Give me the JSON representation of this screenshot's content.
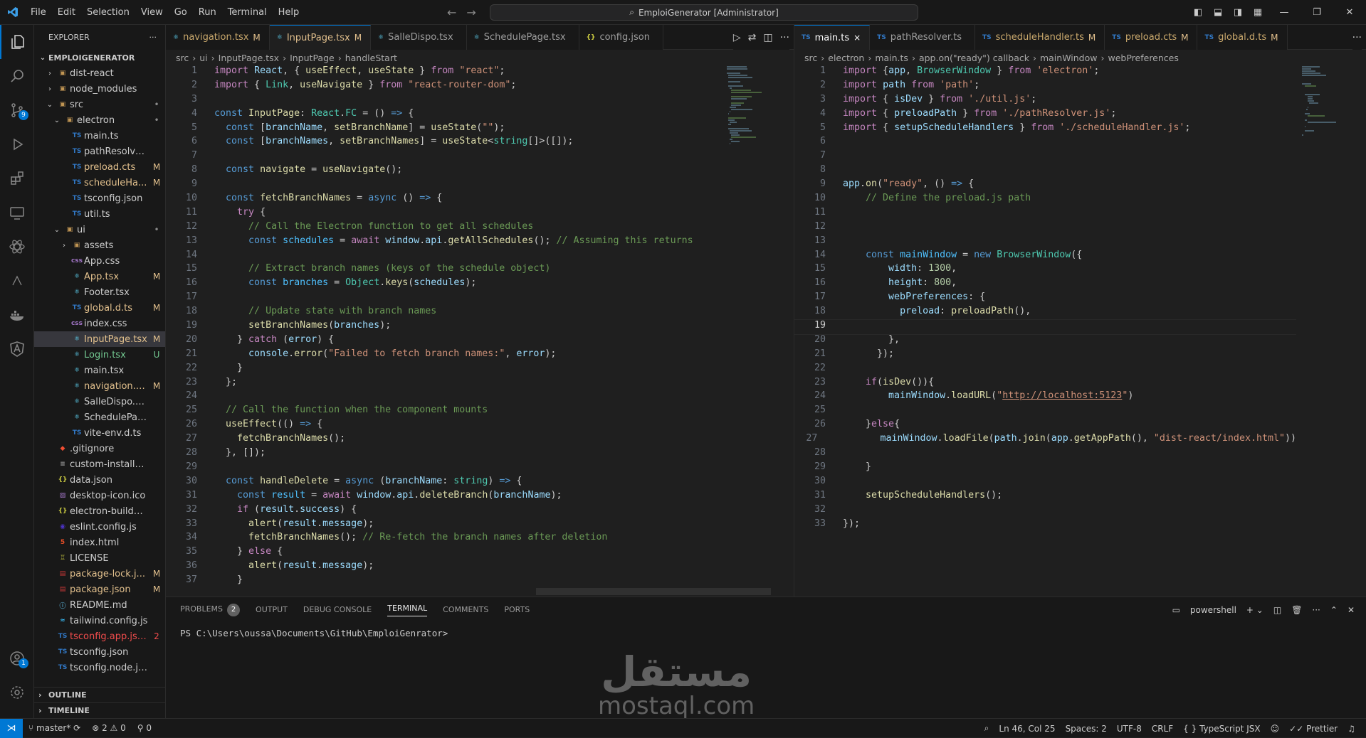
{
  "titlebar": {
    "menu": [
      "File",
      "Edit",
      "Selection",
      "View",
      "Go",
      "Run",
      "Terminal",
      "Help"
    ],
    "command_center": "EmploiGenerator [Administrator]"
  },
  "activity": {
    "source_control_badge": "9",
    "account_badge": "1"
  },
  "explorer": {
    "title": "EXPLORER",
    "root": "EMPLOIGENERATOR",
    "items": [
      {
        "name": "dist-react",
        "kind": "folder",
        "indent": 1,
        "status": ""
      },
      {
        "name": "node_modules",
        "kind": "folder",
        "indent": 1,
        "status": ""
      },
      {
        "name": "src",
        "kind": "folder-open",
        "indent": 1,
        "status": "•"
      },
      {
        "name": "electron",
        "kind": "folder-open",
        "indent": 2,
        "status": "•"
      },
      {
        "name": "main.ts",
        "kind": "ts",
        "indent": 3,
        "status": ""
      },
      {
        "name": "pathResolver.ts",
        "kind": "ts",
        "indent": 3,
        "status": ""
      },
      {
        "name": "preload.cts",
        "kind": "ts",
        "indent": 3,
        "status": "M"
      },
      {
        "name": "scheduleHa...",
        "kind": "ts",
        "indent": 3,
        "status": "M"
      },
      {
        "name": "tsconfig.json",
        "kind": "ts",
        "indent": 3,
        "status": ""
      },
      {
        "name": "util.ts",
        "kind": "ts",
        "indent": 3,
        "status": ""
      },
      {
        "name": "ui",
        "kind": "folder-open",
        "indent": 2,
        "status": "•"
      },
      {
        "name": "assets",
        "kind": "folder",
        "indent": 3,
        "status": ""
      },
      {
        "name": "App.css",
        "kind": "css",
        "indent": 3,
        "status": ""
      },
      {
        "name": "App.tsx",
        "kind": "react",
        "indent": 3,
        "status": "M"
      },
      {
        "name": "Footer.tsx",
        "kind": "react",
        "indent": 3,
        "status": ""
      },
      {
        "name": "global.d.ts",
        "kind": "ts",
        "indent": 3,
        "status": "M"
      },
      {
        "name": "index.css",
        "kind": "css",
        "indent": 3,
        "status": ""
      },
      {
        "name": "InputPage.tsx",
        "kind": "react",
        "indent": 3,
        "status": "M",
        "selected": true
      },
      {
        "name": "Login.tsx",
        "kind": "react",
        "indent": 3,
        "status": "U"
      },
      {
        "name": "main.tsx",
        "kind": "react",
        "indent": 3,
        "status": ""
      },
      {
        "name": "navigation.tsx",
        "kind": "react",
        "indent": 3,
        "status": "M"
      },
      {
        "name": "SalleDispo.tsx",
        "kind": "react",
        "indent": 3,
        "status": ""
      },
      {
        "name": "SchedulePage.tsx",
        "kind": "react",
        "indent": 3,
        "status": ""
      },
      {
        "name": "vite-env.d.ts",
        "kind": "ts",
        "indent": 3,
        "status": ""
      },
      {
        "name": ".gitignore",
        "kind": "git",
        "indent": 1,
        "status": ""
      },
      {
        "name": "custom-installer.nsh",
        "kind": "plain",
        "indent": 1,
        "status": ""
      },
      {
        "name": "data.json",
        "kind": "json",
        "indent": 1,
        "status": ""
      },
      {
        "name": "desktop-icon.ico",
        "kind": "img",
        "indent": 1,
        "status": ""
      },
      {
        "name": "electron-builder.json",
        "kind": "json",
        "indent": 1,
        "status": ""
      },
      {
        "name": "eslint.config.js",
        "kind": "eslint",
        "indent": 1,
        "status": ""
      },
      {
        "name": "index.html",
        "kind": "html",
        "indent": 1,
        "status": ""
      },
      {
        "name": "LICENSE",
        "kind": "license",
        "indent": 1,
        "status": ""
      },
      {
        "name": "package-lock.j...",
        "kind": "npm",
        "indent": 1,
        "status": "M"
      },
      {
        "name": "package.json",
        "kind": "npm",
        "indent": 1,
        "status": "M"
      },
      {
        "name": "README.md",
        "kind": "md",
        "indent": 1,
        "status": ""
      },
      {
        "name": "tailwind.config.js",
        "kind": "tw",
        "indent": 1,
        "status": ""
      },
      {
        "name": "tsconfig.app.json",
        "kind": "ts",
        "indent": 1,
        "status": "2"
      },
      {
        "name": "tsconfig.json",
        "kind": "ts",
        "indent": 1,
        "status": ""
      },
      {
        "name": "tsconfig.node.json",
        "kind": "ts",
        "indent": 1,
        "status": ""
      }
    ],
    "outline": "OUTLINE",
    "timeline": "TIMELINE"
  },
  "left_editor": {
    "tabs": [
      {
        "icon": "react",
        "label": "navigation.tsx",
        "mod": "M",
        "active": false
      },
      {
        "icon": "react",
        "label": "InputPage.tsx",
        "mod": "M",
        "active": true
      },
      {
        "icon": "react",
        "label": "SalleDispo.tsx",
        "mod": "",
        "active": false
      },
      {
        "icon": "react",
        "label": "SchedulePage.tsx",
        "mod": "",
        "active": false
      },
      {
        "icon": "json",
        "label": "config.json",
        "mod": "",
        "active": false
      }
    ],
    "breadcrumb": [
      "src",
      "ui",
      "InputPage.tsx",
      "InputPage",
      "handleStart"
    ],
    "lines": [
      "[[k|import]] [[v|React]], { [[f|useEffect]], [[f|useState]] } [[k|from]] [[s|\"react\"]];",
      "[[k|import]] { [[t|Link]], [[f|useNavigate]] } [[k|from]] [[s|\"react-router-dom\"]];",
      "",
      "[[kw|const]] [[f|InputPage]]: [[t|React]].[[t|FC]] = () [[kw|=>]] {",
      "  [[kw|const]] [[[v|branchName]], [[f|setBranchName]]] = [[f|useState]]([[s|\"\"]]);",
      "  [[kw|const]] [[[v|branchNames]], [[f|setBranchNames]]] = [[f|useState]]<[[t|string]][]>([]);",
      "",
      "  [[kw|const]] [[f|navigate]] = [[f|useNavigate]]();",
      "",
      "  [[kw|const]] [[f|fetchBranchNames]] = [[kw|async]] () [[kw|=>]] {",
      "    [[k|try]] {",
      "      [[c|// Call the Electron function to get all schedules]]",
      "      [[kw|const]] [[cn|schedules]] = [[k|await]] [[v|window]].[[v|api]].[[f|getAllSchedules]](); [[c|// Assuming this returns]]",
      "",
      "      [[c|// Extract branch names (keys of the schedule object)]]",
      "      [[kw|const]] [[cn|branches]] = [[t|Object]].[[f|keys]]([[v|schedules]]);",
      "",
      "      [[c|// Update state with branch names]]",
      "      [[f|setBranchNames]]([[v|branches]]);",
      "    } [[k|catch]] ([[v|error]]) {",
      "      [[v|console]].[[f|error]]([[s|\"Failed to fetch branch names:\"]], [[v|error]]);",
      "    }",
      "  };",
      "",
      "  [[c|// Call the function when the component mounts]]",
      "  [[f|useEffect]](() [[kw|=>]] {",
      "    [[f|fetchBranchNames]]();",
      "  }, []);",
      "",
      "  [[kw|const]] [[f|handleDelete]] = [[kw|async]] ([[v|branchName]]: [[t|string]]) [[kw|=>]] {",
      "    [[kw|const]] [[cn|result]] = [[k|await]] [[v|window]].[[v|api]].[[f|deleteBranch]]([[v|branchName]]);",
      "    [[k|if]] ([[v|result]].[[v|success]]) {",
      "      [[f|alert]]([[v|result]].[[v|message]]);",
      "      [[f|fetchBranchNames]](); [[c|// Re-fetch the branch names after deletion]]",
      "    } [[k|else]] {",
      "      [[f|alert]]([[v|result]].[[v|message]]);",
      "    }"
    ]
  },
  "right_editor": {
    "tabs": [
      {
        "icon": "ts",
        "label": "main.ts",
        "mod": "×",
        "active": true
      },
      {
        "icon": "ts",
        "label": "pathResolver.ts",
        "mod": "",
        "active": false
      },
      {
        "icon": "ts",
        "label": "scheduleHandler.ts",
        "mod": "M",
        "active": false
      },
      {
        "icon": "ts",
        "label": "preload.cts",
        "mod": "M",
        "active": false
      },
      {
        "icon": "ts",
        "label": "global.d.ts",
        "mod": "M",
        "active": false
      }
    ],
    "breadcrumb": [
      "src",
      "electron",
      "main.ts",
      "app.on(\"ready\") callback",
      "mainWindow",
      "webPreferences"
    ],
    "lines": [
      "[[k|import]] {[[v|app]], [[t|BrowserWindow]] } [[k|from]] [[s|'electron']];",
      "[[k|import]] [[v|path]] [[k|from]] [[s|'path']];",
      "[[k|import]] { [[v|isDev]] } [[k|from]] [[s|'./util.js']];",
      "[[k|import]] { [[v|preloadPath]] } [[k|from]] [[s|'./pathResolver.js']];",
      "[[k|import]] { [[v|setupScheduleHandlers]] } [[k|from]] [[s|'./scheduleHandler.js']];",
      "",
      "",
      "",
      "[[v|app]].[[f|on]]([[s|\"ready\"]], () [[kw|=>]] {",
      "    [[c|// Define the preload.js path]]",
      "",
      "",
      "",
      "    [[kw|const]] [[cn|mainWindow]] = [[kw|new]] [[t|BrowserWindow]]({",
      "        [[v|width]]: [[n|1300]],",
      "        [[v|height]]: [[n|800]],",
      "        [[v|webPreferences]]: {",
      "          [[v|preload]]: [[f|preloadPath]](),",
      "",
      "        },",
      "      });",
      "",
      "    [[k|if]]([[f|isDev]]()){",
      "        [[v|mainWindow]].[[f|loadURL]]([[s|\"]][[u|http://localhost:5123]][[s|\"]])",
      "",
      "    }[[k|else]]{",
      "        [[v|mainWindow]].[[f|loadFile]]([[v|path]].[[f|join]]([[v|app]].[[f|getAppPath]](), [[s|\"dist-react/index.html\"]]))",
      "",
      "    }",
      "",
      "    [[f|setupScheduleHandlers]]();",
      "",
      "});"
    ],
    "current_line": 19
  },
  "panel": {
    "tabs": [
      "PROBLEMS",
      "OUTPUT",
      "DEBUG CONSOLE",
      "TERMINAL",
      "COMMENTS",
      "PORTS"
    ],
    "problems_count": "2",
    "active": "TERMINAL",
    "shell": "powershell",
    "prompt": "PS C:\\Users\\oussa\\Documents\\GitHub\\EmploiGenrator>"
  },
  "watermark": {
    "arabic": "مستقل",
    "latin": "mostaql.com"
  },
  "statusbar": {
    "branch": "master*",
    "errors": "2",
    "warnings": "0",
    "ports": "0",
    "position": "Ln 46, Col 25",
    "spaces": "Spaces: 2",
    "encoding": "UTF-8",
    "eol": "CRLF",
    "language": "TypeScript JSX",
    "formatter": "Prettier"
  },
  "colors": {
    "accent": "#0078d4",
    "bg": "#1f1f1f",
    "sidebar": "#181818",
    "modified": "#e2c08d",
    "untracked": "#73c991",
    "error": "#f14c4c"
  }
}
